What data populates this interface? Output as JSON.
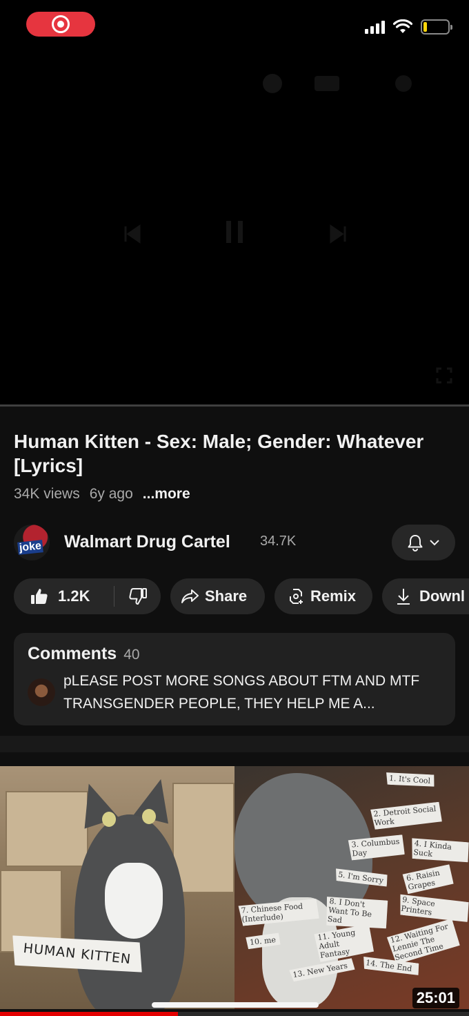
{
  "status_bar": {
    "recording_indicator": "record-icon",
    "battery_level": 0.15,
    "signal_bars": 4,
    "colors": {
      "recording": "#e6353f",
      "battery": "#ffd60a"
    }
  },
  "player": {
    "progress": 0.0,
    "icons": [
      "cast-icon",
      "captions-icon",
      "settings-icon",
      "previous-icon",
      "pause-icon",
      "next-icon"
    ]
  },
  "video": {
    "title": "Human Kitten - Sex: Male; Gender: Whatever [Lyrics]",
    "views": "34K views",
    "age": "6y ago",
    "more_label": "...more"
  },
  "channel": {
    "avatar_text": "joke",
    "name": "Walmart Drug Cartel",
    "subscribers": "34.7K"
  },
  "actions": {
    "likes": "1.2K",
    "share_label": "Share",
    "remix_label": "Remix",
    "download_label": "Downl"
  },
  "comments": {
    "title": "Comments",
    "count": "40",
    "top_comment": "pLEASE POST MORE SONGS ABOUT FTM AND MTF TRANSGENDER PEOPLE, THEY HELP ME A..."
  },
  "next_video": {
    "thumbnail_label": "HUMAN KITTEN",
    "duration": "25:01",
    "tracklist": [
      "1. It's Cool",
      "2. Detroit Social Work",
      "3. Columbus Day",
      "4. I Kinda Suck",
      "5. I'm Sorry",
      "6. Raisin Grapes",
      "7. Chinese Food (Interlude)",
      "8. I Don't Want To Be Sad",
      "9. Space Printers",
      "10. me",
      "11. Young Adult Fantasy",
      "12. Waiting For Lennie The Second Time",
      "13. New Years",
      "14. The End"
    ],
    "watch_progress": 0.38
  },
  "colors": {
    "background": "#0f0f0f",
    "surface": "#272727",
    "accent_red": "#e30000",
    "secondary_text": "#aaaaaa"
  }
}
